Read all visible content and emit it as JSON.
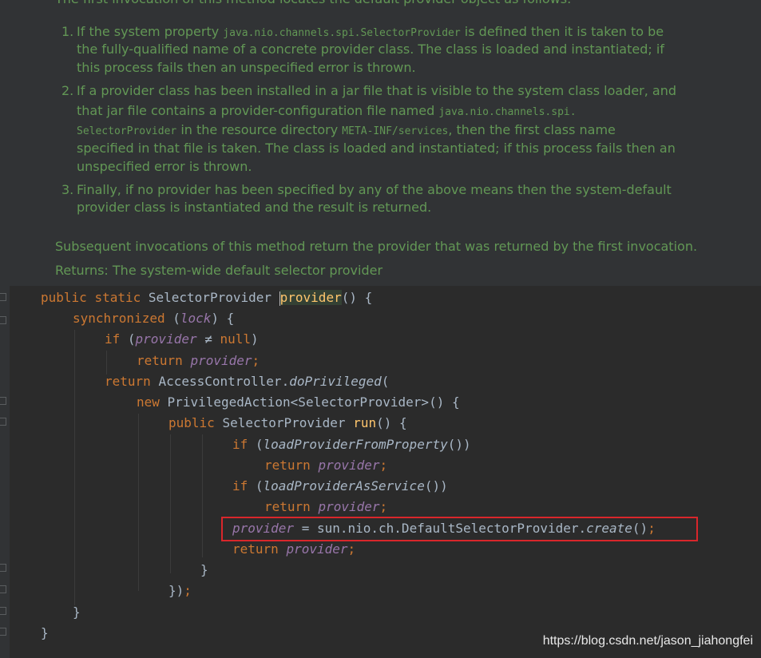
{
  "doc": {
    "intro_clipped": "The first invocation of this method locates the default provider object as follows:",
    "item1": {
      "num": "1.",
      "l1a": "If the system property ",
      "l1code": "java.nio.channels.spi.SelectorProvider",
      "l1b": " is defined then it is taken to be",
      "l2": "the fully-qualified name of a concrete provider class. The class is loaded and instantiated; if",
      "l3": "this process fails then an unspecified error is thrown."
    },
    "item2": {
      "num": "2.",
      "l1": "If a provider class has been installed in a jar file that is visible to the system class loader, and",
      "l2a": "that jar file contains a provider-configuration file named ",
      "l2code": "java.nio.channels.spi.",
      "l3code": "SelectorProvider",
      "l3a": " in the resource directory ",
      "l3code2": "META-INF/services",
      "l3b": ", then the first class name",
      "l4": "specified in that file is taken. The class is loaded and instantiated; if this process fails then an",
      "l5": "unspecified error is thrown."
    },
    "item3": {
      "num": "3.",
      "l1": "Finally, if no provider has been specified by any of the above means then the system-default",
      "l2": "provider class is instantiated and the result is returned."
    },
    "subsequent": "Subsequent invocations of this method return the provider that was returned by the first invocation.",
    "returns": "Returns: The system-wide default selector provider"
  },
  "code": {
    "kw_public": "public",
    "kw_static": "static",
    "kw_synchronized": "synchronized",
    "kw_if": "if",
    "kw_return": "return",
    "kw_new": "new",
    "kw_null": "null",
    "type_selector_provider": "SelectorProvider",
    "method_provider": "provider",
    "field_lock": "lock",
    "field_provider": "provider",
    "access_controller": "AccessController.",
    "do_privileged": "doPrivileged",
    "privileged_action": "PrivilegedAction<SelectorProvider>",
    "method_run": "run",
    "load_from_property": "loadProviderFromProperty",
    "load_as_service": "loadProviderAsService",
    "default_provider": "sun.nio.ch.DefaultSelectorProvider.",
    "create": "create",
    "not_equal": "≠"
  },
  "watermark": "https://blog.csdn.net/jason_jiahongfei",
  "colors": {
    "keyword": "#cc7832",
    "field": "#9876aa",
    "method": "#ffc66d",
    "doc_text": "#629755",
    "highlight_box": "#d9262b"
  }
}
